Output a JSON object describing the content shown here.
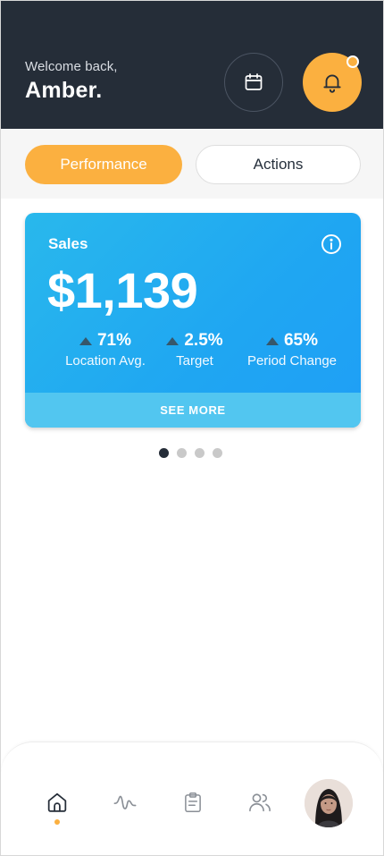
{
  "header": {
    "welcome_text": "Welcome back,",
    "user_name": "Amber.",
    "calendar_icon": "calendar-icon",
    "bell_icon": "bell-icon",
    "has_notification": true
  },
  "tabs": [
    {
      "label": "Performance",
      "active": true
    },
    {
      "label": "Actions",
      "active": false
    }
  ],
  "sales_card": {
    "title": "Sales",
    "amount": "$1,139",
    "info_icon": "info-icon",
    "stats": [
      {
        "value": "71%",
        "label": "Location Avg.",
        "trend": "up"
      },
      {
        "value": "2.5%",
        "label": "Target",
        "trend": "up"
      },
      {
        "value": "65%",
        "label": "Period Change",
        "trend": "up"
      }
    ],
    "see_more_label": "SEE MORE"
  },
  "pager": {
    "total": 4,
    "active_index": 0
  },
  "bottom_nav": {
    "items": [
      {
        "icon": "home-icon",
        "active": true
      },
      {
        "icon": "activity-icon",
        "active": false
      },
      {
        "icon": "clipboard-icon",
        "active": false
      },
      {
        "icon": "users-icon",
        "active": false
      },
      {
        "icon": "avatar",
        "active": false
      }
    ]
  },
  "colors": {
    "header_bg": "#252d38",
    "accent": "#fbb040",
    "card_blue": "#1fa6f2",
    "see_more_bg": "#52c6f0",
    "trend_up": "#36576b"
  }
}
